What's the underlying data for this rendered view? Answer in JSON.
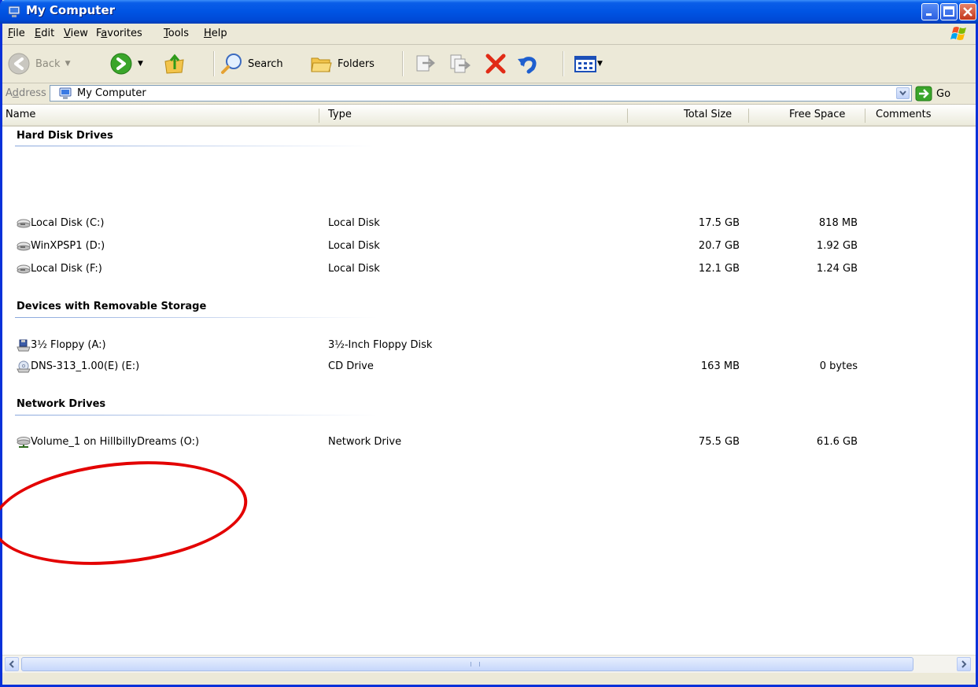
{
  "window": {
    "title": "My Computer",
    "controls": [
      "minimize-icon",
      "maximize-icon",
      "close-icon"
    ]
  },
  "menu": [
    {
      "key": "F",
      "rest": "ile"
    },
    {
      "key": "E",
      "rest": "dit"
    },
    {
      "key": "V",
      "rest": "iew"
    },
    {
      "pre": "F",
      "key": "a",
      "rest": "vorites"
    },
    {
      "key": "T",
      "rest": "ools"
    },
    {
      "key": "H",
      "rest": "elp"
    }
  ],
  "toolbar": {
    "back_label": "Back",
    "search_label": "Search",
    "folders_label": "Folders"
  },
  "address": {
    "label_pre": "A",
    "label_key": "d",
    "label_rest": "dress",
    "value": "My Computer",
    "go_label": "Go"
  },
  "columns": {
    "name": "Name",
    "type": "Type",
    "total": "Total Size",
    "free": "Free Space",
    "comments": "Comments"
  },
  "groups": [
    {
      "title": "Hard Disk Drives",
      "items": [
        {
          "icon": "hard-disk-icon",
          "name": "Local Disk (C:)",
          "type": "Local Disk",
          "total": "17.5 GB",
          "free": "818 MB"
        },
        {
          "icon": "hard-disk-icon",
          "name": "WinXPSP1 (D:)",
          "type": "Local Disk",
          "total": "20.7 GB",
          "free": "1.92 GB"
        },
        {
          "icon": "hard-disk-icon",
          "name": "Local Disk (F:)",
          "type": "Local Disk",
          "total": "12.1 GB",
          "free": "1.24 GB"
        }
      ]
    },
    {
      "title": "Devices with Removable Storage",
      "items": [
        {
          "icon": "floppy-drive-icon",
          "name": "3½ Floppy (A:)",
          "type": "3½-Inch Floppy Disk",
          "total": "",
          "free": ""
        },
        {
          "icon": "cd-drive-icon",
          "name": "DNS-313_1.00(E) (E:)",
          "type": "CD Drive",
          "total": "163 MB",
          "free": "0 bytes"
        }
      ]
    },
    {
      "title": "Network Drives",
      "items": [
        {
          "icon": "network-drive-icon",
          "name": "Volume_1 on HillbillyDreams (O:)",
          "type": "Network Drive",
          "total": "75.5 GB",
          "free": "61.6 GB"
        }
      ]
    }
  ],
  "colors": {
    "title_bar": "#0054e3",
    "annotation": "#e30000",
    "group_line": "#89a7dc"
  }
}
